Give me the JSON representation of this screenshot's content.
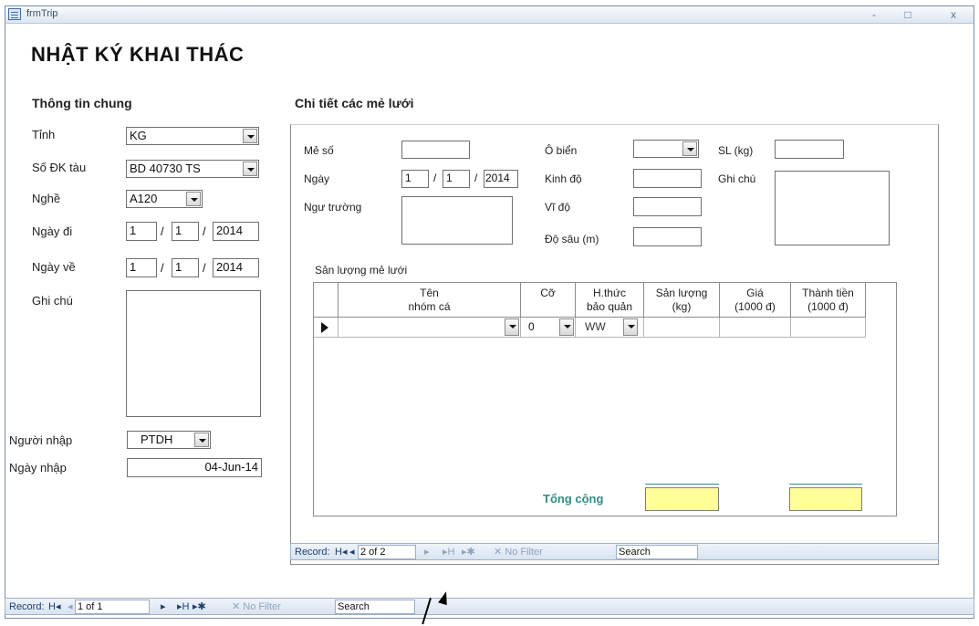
{
  "window": {
    "title": "frmTrip",
    "minimize": "‑",
    "maximize": "□",
    "close": "x"
  },
  "heading": "NHẬT KÝ KHAI THÁC",
  "general": {
    "section": "Thông tin chung",
    "province_label": "Tỉnh",
    "province_value": "KG",
    "registration_label": "Số ĐK tàu",
    "registration_value": "BD 40730 TS",
    "gear_label": "Nghề",
    "gear_value": "A120",
    "depart_label": "Ngày đi",
    "depart_d": "1",
    "depart_m": "1",
    "depart_y": "2014",
    "return_label": "Ngày về",
    "return_d": "1",
    "return_m": "1",
    "return_y": "2014",
    "note_label": "Ghi chú",
    "note_value": "",
    "entered_by_label": "Người nhập",
    "entered_by_value": "PTDH",
    "entry_date_label": "Ngày nhập",
    "entry_date_value": "04-Jun-14",
    "date_sep": "/"
  },
  "haul": {
    "section": "Chi tiết các mẻ lưới",
    "haul_no_label": "Mẻ số",
    "haul_no_value": "",
    "date_label": "Ngày",
    "date_d": "1",
    "date_m": "1",
    "date_y": "2014",
    "ground_label": "Ngư trường",
    "ground_value": "",
    "square_label": "Ô biển",
    "square_value": "",
    "lon_label": "Kinh độ",
    "lon_value": "",
    "lat_label": "Vĩ độ",
    "lat_value": "",
    "depth_label": "Độ sâu (m)",
    "depth_value": "",
    "qty_label": "SL (kg)",
    "qty_value": "",
    "note_label": "Ghi chú",
    "note_value": "",
    "catch_label": "Sản lượng mẻ lưới",
    "columns": {
      "species_1": "Tên",
      "species_2": "nhóm cá",
      "size": "Cỡ",
      "pres_1": "H.thức",
      "pres_2": "bảo quản",
      "amount_1": "Sản lượng",
      "amount_2": "(kg)",
      "price_1": "Giá",
      "price_2": "(1000 đ)",
      "total_1": "Thành tiền",
      "total_2": "(1000 đ)"
    },
    "row": {
      "species": "",
      "size": "0",
      "pres": "WW",
      "amount": "",
      "price": "",
      "total": ""
    },
    "total_label": "Tổng cộng"
  },
  "sub_nav": {
    "record_label": "Record:",
    "position": "2 of 2",
    "filter": "No Filter",
    "search": "Search"
  },
  "main_nav": {
    "record_label": "Record:",
    "position": "1 of 1",
    "filter": "No Filter",
    "search": "Search"
  },
  "icons": {
    "first": "H◂",
    "prev": "◂",
    "next": "▸",
    "last": "▸H",
    "new": "▸✱"
  }
}
